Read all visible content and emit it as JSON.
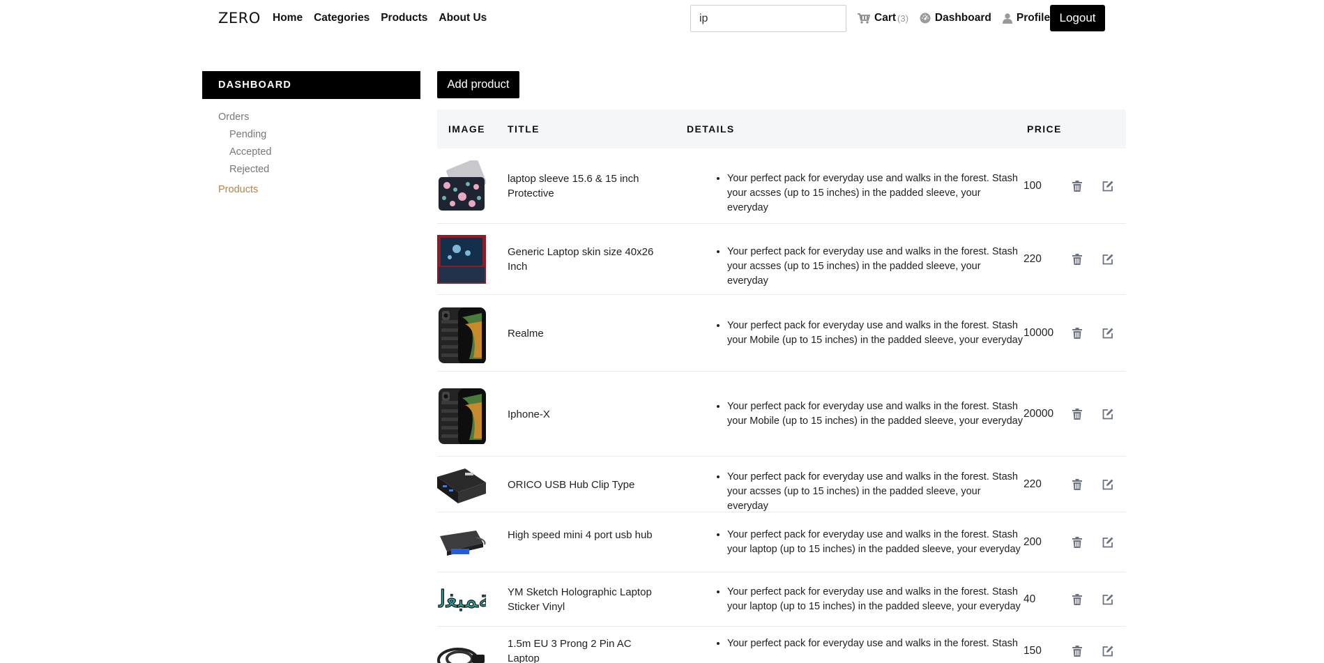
{
  "header": {
    "brand": "ZERO",
    "nav": [
      "Home",
      "Categories",
      "Products",
      "About Us"
    ],
    "search_value": "ip",
    "cart_label": "Cart",
    "cart_count": "(3)",
    "dashboard_label": "Dashboard",
    "profile_label": "Profile",
    "logout_label": "Logout"
  },
  "sidebar": {
    "title": "DASHBOARD",
    "orders_label": "Orders",
    "order_items": [
      "Pending",
      "Accepted",
      "Rejected"
    ],
    "products_label": "Products"
  },
  "main": {
    "add_button": "Add product",
    "columns": {
      "image": "IMAGE",
      "title": "TITLE",
      "details": "DETAILS",
      "price": "PRICE"
    },
    "products": [
      {
        "title": "laptop sleeve 15.6 & 15 inch Protective",
        "details": "Your perfect pack for everyday use and walks in the forest. Stash your acsses (up to 15 inches) in the padded sleeve, your everyday",
        "price": "100",
        "icon": "laptop-sleeve-image"
      },
      {
        "title": "Generic Laptop skin size 40x26 Inch",
        "details": "Your perfect pack for everyday use and walks in the forest. Stash your acsses (up to 15 inches) in the padded sleeve, your everyday",
        "price": "220",
        "icon": "laptop-skin-image"
      },
      {
        "title": "Realme",
        "details": "Your perfect pack for everyday use and walks in the forest. Stash your Mobile (up to 15 inches) in the padded sleeve, your everyday",
        "price": "10000",
        "icon": "phone-image"
      },
      {
        "title": "Iphone-X",
        "details": "Your perfect pack for everyday use and walks in the forest. Stash your Mobile (up to 15 inches) in the padded sleeve, your everyday",
        "price": "20000",
        "icon": "phone-image"
      },
      {
        "title": "ORICO USB Hub Clip Type",
        "details": "Your perfect pack for everyday use and walks in the forest. Stash your acsses (up to 15 inches) in the padded sleeve, your everyday",
        "price": "220",
        "icon": "usb-hub-clip-image"
      },
      {
        "title": "High speed mini 4 port usb hub",
        "details": "Your perfect pack for everyday use and walks in the forest. Stash your laptop (up to 15 inches) in the padded sleeve, your everyday",
        "price": "200",
        "icon": "usb-hub-image"
      },
      {
        "title": "YM Sketch Holographic Laptop Sticker Vinyl",
        "details": "Your perfect pack for everyday use and walks in the forest. Stash your laptop (up to 15 inches) in the padded sleeve, your everyday",
        "price": "40",
        "icon": "sticker-image"
      },
      {
        "title": "1.5m EU 3 Prong 2 Pin AC Laptop",
        "details": "Your perfect pack for everyday use and walks in the forest. Stash",
        "price": "150",
        "icon": "power-cable-image"
      }
    ]
  },
  "colors": {
    "accent": "#b5834a",
    "primary": "#000000",
    "header_bg": "#f5f6f8",
    "icon_gray": "#6b7280"
  }
}
